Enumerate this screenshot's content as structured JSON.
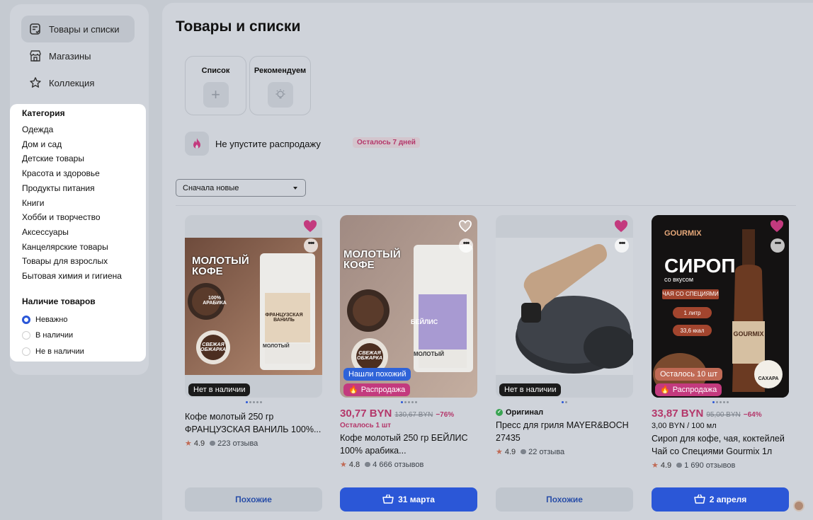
{
  "sidebar": {
    "nav": [
      {
        "label": "Товары и списки",
        "icon": "list-check-icon",
        "active": true
      },
      {
        "label": "Магазины",
        "icon": "store-icon",
        "active": false
      },
      {
        "label": "Коллекция",
        "icon": "star-icon",
        "active": false
      }
    ],
    "category_title": "Категория",
    "categories": [
      "Одежда",
      "Дом и сад",
      "Детские товары",
      "Красота и здоровье",
      "Продукты питания",
      "Книги",
      "Хобби и творчество",
      "Аксессуары",
      "Канцелярские товары",
      "Товары для взрослых",
      "Бытовая химия и гигиена"
    ],
    "availability_title": "Наличие товаров",
    "availability": [
      {
        "label": "Неважно",
        "selected": true
      },
      {
        "label": "В наличии",
        "selected": false
      },
      {
        "label": "Не в наличии",
        "selected": false
      }
    ]
  },
  "main": {
    "title": "Товары и списки",
    "tiles": [
      {
        "label": "Список",
        "icon": "plus-icon"
      },
      {
        "label": "Рекомендуем",
        "icon": "lightbulb-icon"
      }
    ],
    "sale_banner": {
      "text": "Не упустите распродажу",
      "badge": "Осталось 7 дней"
    },
    "sort": {
      "value": "Сначала новые"
    }
  },
  "cards": [
    {
      "badges": [
        {
          "text": "Нет в наличии",
          "style": "dark"
        }
      ],
      "title": "Кофе молотый 250 гр ФРАНЦУЗСКАЯ ВАНИЛЬ 100%...",
      "rating": "4.9",
      "reviews": "223 отзыва",
      "button": "Похожие",
      "heart_filled": true,
      "pager_total": 5,
      "photo_text": {
        "line1": "МОЛОТЫЙ",
        "line2": "КОФЕ",
        "pack": "ФРАНЦУЗСКАЯ ВАНИЛЬ",
        "round": "100% АРАБИКА",
        "fresh": "СВЕЖАЯ ОБЖАРКА",
        "ground": "МОЛОТЫЙ"
      }
    },
    {
      "badges": [
        {
          "text": "Нашли похожий",
          "style": "blue"
        },
        {
          "text": "Распродажа",
          "style": "pink"
        }
      ],
      "price": "30,77 BYN",
      "old_price": "130,67 BYN",
      "discount": "−76%",
      "stock": "Осталось 1 шт",
      "title": "Кофе молотый 250 гр БЕЙЛИС 100% арабика...",
      "rating": "4.8",
      "reviews": "4 666 отзывов",
      "button": "31 марта",
      "heart_filled": false,
      "pager_total": 5,
      "photo_text": {
        "line1": "МОЛОТЫЙ",
        "line2": "КОФЕ",
        "pack": "БЕЙЛИС",
        "fresh": "СВЕЖАЯ ОБЖАРКА",
        "ground": "МОЛОТЫЙ"
      }
    },
    {
      "badges": [
        {
          "text": "Нет в наличии",
          "style": "dark"
        }
      ],
      "original": "Оригинал",
      "title": "Пресс для гриля MAYER&BOCH 27435",
      "rating": "4.9",
      "reviews": "22 отзыва",
      "button": "Похожие",
      "heart_filled": true,
      "pager_total": 2
    },
    {
      "badges": [
        {
          "text": "Осталось 10 шт",
          "style": "orange"
        },
        {
          "text": "Распродажа",
          "style": "pink"
        }
      ],
      "price": "33,87 BYN",
      "old_price": "95,00 BYN",
      "discount": "−64%",
      "unit_price": "3,00 BYN / 100 мл",
      "title": "Сироп для кофе, чая, коктейлей Чай со Специями Gourmix 1л",
      "rating": "4.9",
      "reviews": "1 690 отзывов",
      "button": "2 апреля",
      "heart_filled": true,
      "pager_total": 5,
      "photo_text": {
        "brand": "GOURMIX",
        "big": "СИРОП",
        "sub": "со вкусом",
        "flavor": "ЧАЯ СО СПЕЦИЯМИ",
        "liter": "1 литр",
        "kcal": "33,6 ккал",
        "sugar": "САХАРА",
        "bottle": "GOURMIX"
      }
    }
  ]
}
